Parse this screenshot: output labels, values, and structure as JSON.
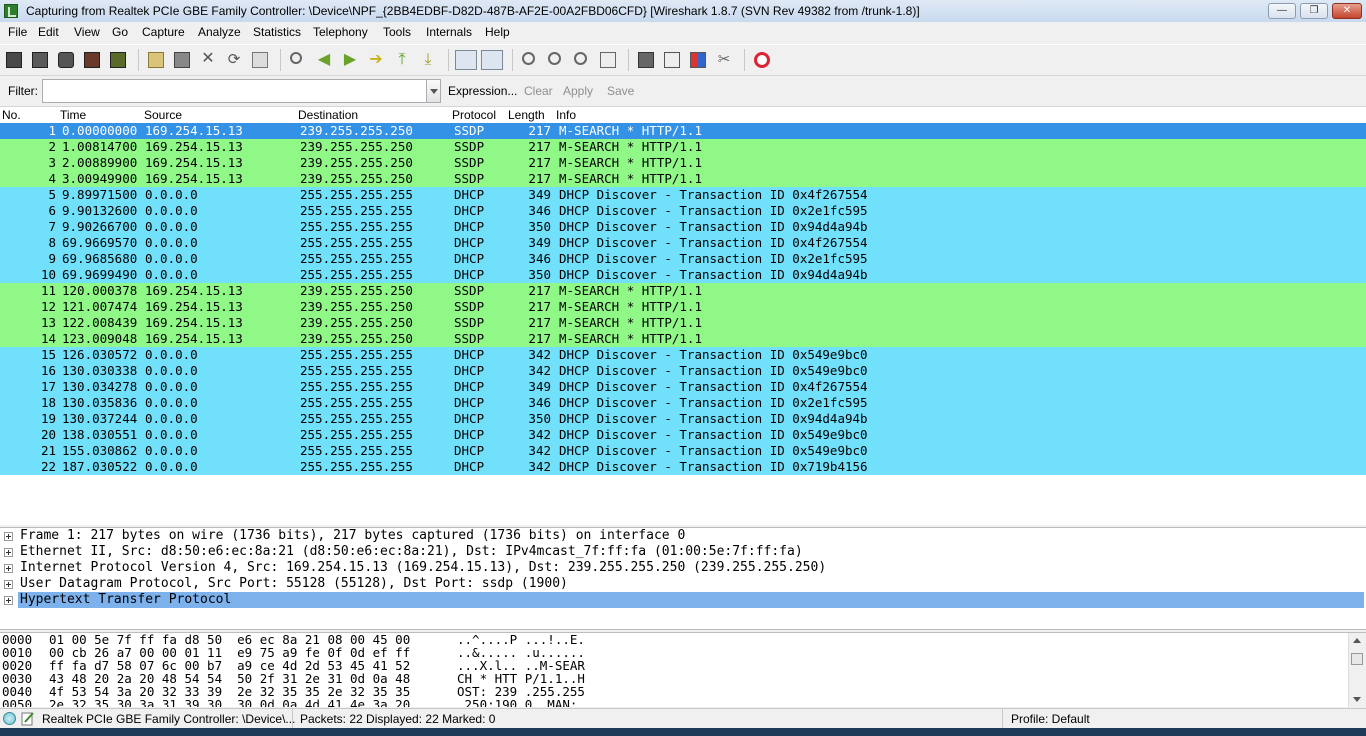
{
  "window": {
    "title": "Capturing from Realtek PCIe GBE Family Controller: \\Device\\NPF_{2BB4EDBF-D82D-487B-AF2E-00A2FBD06CFD}   [Wireshark 1.8.7  (SVN Rev 49382 from /trunk-1.8)]",
    "minimize_label": "—",
    "maximize_label": "❐",
    "close_label": "✕"
  },
  "menu": [
    "File",
    "Edit",
    "View",
    "Go",
    "Capture",
    "Analyze",
    "Statistics",
    "Telephony",
    "Tools",
    "Internals",
    "Help"
  ],
  "toolbar_icons": [
    "interfaces-icon",
    "capture-options-icon",
    "start-capture-icon",
    "stop-capture-icon",
    "restart-capture-icon",
    "open-file-icon",
    "save-file-icon",
    "close-file-icon",
    "reload-icon",
    "print-icon",
    "find-packet-icon",
    "go-back-icon",
    "go-forward-icon",
    "go-to-packet-icon",
    "go-first-icon",
    "go-last-icon",
    "colorize-icon",
    "auto-scroll-icon",
    "zoom-in-icon",
    "zoom-out-icon",
    "zoom-normal-icon",
    "resize-columns-icon",
    "capture-filters-icon",
    "display-filters-icon",
    "coloring-rules-icon",
    "preferences-icon",
    "help-icon"
  ],
  "filter": {
    "label": "Filter:",
    "value": "",
    "placeholder": "",
    "expression": "Expression...",
    "clear": "Clear",
    "apply": "Apply",
    "save": "Save"
  },
  "packet_list": {
    "columns": {
      "no": "No.",
      "time": "Time",
      "source": "Source",
      "destination": "Destination",
      "protocol": "Protocol",
      "length": "Length",
      "info": "Info"
    },
    "colors": {
      "SSDP": "#8ff886",
      "DHCP": "#70e0fb",
      "selected": "#3391e6"
    },
    "selected_index": 0,
    "rows": [
      {
        "no": "1",
        "time": "0.00000000",
        "source": "169.254.15.13",
        "destination": "239.255.255.250",
        "protocol": "SSDP",
        "length": "217",
        "info": "M-SEARCH * HTTP/1.1"
      },
      {
        "no": "2",
        "time": "1.00814700",
        "source": "169.254.15.13",
        "destination": "239.255.255.250",
        "protocol": "SSDP",
        "length": "217",
        "info": "M-SEARCH * HTTP/1.1"
      },
      {
        "no": "3",
        "time": "2.00889900",
        "source": "169.254.15.13",
        "destination": "239.255.255.250",
        "protocol": "SSDP",
        "length": "217",
        "info": "M-SEARCH * HTTP/1.1"
      },
      {
        "no": "4",
        "time": "3.00949900",
        "source": "169.254.15.13",
        "destination": "239.255.255.250",
        "protocol": "SSDP",
        "length": "217",
        "info": "M-SEARCH * HTTP/1.1"
      },
      {
        "no": "5",
        "time": "9.89971500",
        "source": "0.0.0.0",
        "destination": "255.255.255.255",
        "protocol": "DHCP",
        "length": "349",
        "info": "DHCP Discover - Transaction ID 0x4f267554"
      },
      {
        "no": "6",
        "time": "9.90132600",
        "source": "0.0.0.0",
        "destination": "255.255.255.255",
        "protocol": "DHCP",
        "length": "346",
        "info": "DHCP Discover - Transaction ID 0x2e1fc595"
      },
      {
        "no": "7",
        "time": "9.90266700",
        "source": "0.0.0.0",
        "destination": "255.255.255.255",
        "protocol": "DHCP",
        "length": "350",
        "info": "DHCP Discover - Transaction ID 0x94d4a94b"
      },
      {
        "no": "8",
        "time": "69.9669570",
        "source": "0.0.0.0",
        "destination": "255.255.255.255",
        "protocol": "DHCP",
        "length": "349",
        "info": "DHCP Discover - Transaction ID 0x4f267554"
      },
      {
        "no": "9",
        "time": "69.9685680",
        "source": "0.0.0.0",
        "destination": "255.255.255.255",
        "protocol": "DHCP",
        "length": "346",
        "info": "DHCP Discover - Transaction ID 0x2e1fc595"
      },
      {
        "no": "10",
        "time": "69.9699490",
        "source": "0.0.0.0",
        "destination": "255.255.255.255",
        "protocol": "DHCP",
        "length": "350",
        "info": "DHCP Discover - Transaction ID 0x94d4a94b"
      },
      {
        "no": "11",
        "time": "120.000378",
        "source": "169.254.15.13",
        "destination": "239.255.255.250",
        "protocol": "SSDP",
        "length": "217",
        "info": "M-SEARCH * HTTP/1.1"
      },
      {
        "no": "12",
        "time": "121.007474",
        "source": "169.254.15.13",
        "destination": "239.255.255.250",
        "protocol": "SSDP",
        "length": "217",
        "info": "M-SEARCH * HTTP/1.1"
      },
      {
        "no": "13",
        "time": "122.008439",
        "source": "169.254.15.13",
        "destination": "239.255.255.250",
        "protocol": "SSDP",
        "length": "217",
        "info": "M-SEARCH * HTTP/1.1"
      },
      {
        "no": "14",
        "time": "123.009048",
        "source": "169.254.15.13",
        "destination": "239.255.255.250",
        "protocol": "SSDP",
        "length": "217",
        "info": "M-SEARCH * HTTP/1.1"
      },
      {
        "no": "15",
        "time": "126.030572",
        "source": "0.0.0.0",
        "destination": "255.255.255.255",
        "protocol": "DHCP",
        "length": "342",
        "info": "DHCP Discover - Transaction ID 0x549e9bc0"
      },
      {
        "no": "16",
        "time": "130.030338",
        "source": "0.0.0.0",
        "destination": "255.255.255.255",
        "protocol": "DHCP",
        "length": "342",
        "info": "DHCP Discover - Transaction ID 0x549e9bc0"
      },
      {
        "no": "17",
        "time": "130.034278",
        "source": "0.0.0.0",
        "destination": "255.255.255.255",
        "protocol": "DHCP",
        "length": "349",
        "info": "DHCP Discover - Transaction ID 0x4f267554"
      },
      {
        "no": "18",
        "time": "130.035836",
        "source": "0.0.0.0",
        "destination": "255.255.255.255",
        "protocol": "DHCP",
        "length": "346",
        "info": "DHCP Discover - Transaction ID 0x2e1fc595"
      },
      {
        "no": "19",
        "time": "130.037244",
        "source": "0.0.0.0",
        "destination": "255.255.255.255",
        "protocol": "DHCP",
        "length": "350",
        "info": "DHCP Discover - Transaction ID 0x94d4a94b"
      },
      {
        "no": "20",
        "time": "138.030551",
        "source": "0.0.0.0",
        "destination": "255.255.255.255",
        "protocol": "DHCP",
        "length": "342",
        "info": "DHCP Discover - Transaction ID 0x549e9bc0"
      },
      {
        "no": "21",
        "time": "155.030862",
        "source": "0.0.0.0",
        "destination": "255.255.255.255",
        "protocol": "DHCP",
        "length": "342",
        "info": "DHCP Discover - Transaction ID 0x549e9bc0"
      },
      {
        "no": "22",
        "time": "187.030522",
        "source": "0.0.0.0",
        "destination": "255.255.255.255",
        "protocol": "DHCP",
        "length": "342",
        "info": "DHCP Discover - Transaction ID 0x719b4156"
      }
    ]
  },
  "details": {
    "selected_index": 4,
    "highlight_color": "#7cb1ec",
    "rows": [
      "Frame 1: 217 bytes on wire (1736 bits), 217 bytes captured (1736 bits) on interface 0",
      "Ethernet II, Src: d8:50:e6:ec:8a:21 (d8:50:e6:ec:8a:21), Dst: IPv4mcast_7f:ff:fa (01:00:5e:7f:ff:fa)",
      "Internet Protocol Version 4, Src: 169.254.15.13 (169.254.15.13), Dst: 239.255.255.250 (239.255.255.250)",
      "User Datagram Protocol, Src Port: 55128 (55128), Dst Port: ssdp (1900)",
      "Hypertext Transfer Protocol"
    ]
  },
  "bytes": [
    {
      "offset": "0000",
      "hex": "01 00 5e 7f ff fa d8 50  e6 ec 8a 21 08 00 45 00",
      "ascii": "..^....P ...!..E."
    },
    {
      "offset": "0010",
      "hex": "00 cb 26 a7 00 00 01 11  e9 75 a9 fe 0f 0d ef ff",
      "ascii": "..&..... .u......"
    },
    {
      "offset": "0020",
      "hex": "ff fa d7 58 07 6c 00 b7  a9 ce 4d 2d 53 45 41 52",
      "ascii": "...X.l.. ..M-SEAR"
    },
    {
      "offset": "0030",
      "hex": "43 48 20 2a 20 48 54 54  50 2f 31 2e 31 0d 0a 48",
      "ascii": "CH * HTT P/1.1..H"
    },
    {
      "offset": "0040",
      "hex": "4f 53 54 3a 20 32 33 39  2e 32 35 35 2e 32 35 35",
      "ascii": "OST: 239 .255.255"
    },
    {
      "offset": "0050",
      "hex": "2e 32 35 30 3a 31 39 30  30 0d 0a 4d 41 4e 3a 20",
      "ascii": ".250:190 0..MAN: "
    }
  ],
  "status": {
    "interface": "Realtek PCIe GBE Family Controller: \\Device\\...",
    "packets": "Packets: 22 Displayed: 22 Marked: 0",
    "profile": "Profile: Default"
  }
}
